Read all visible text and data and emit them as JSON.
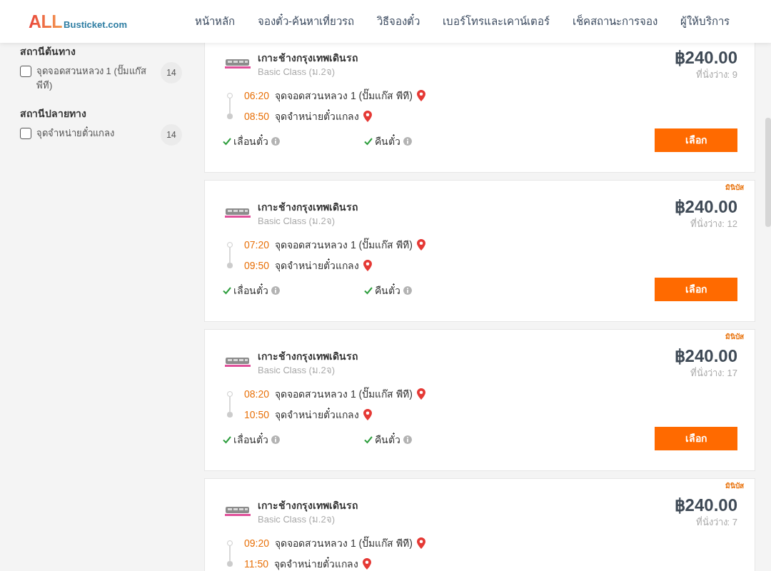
{
  "header": {
    "logo": {
      "brand": "ALL",
      "domain": "Busticket.com"
    },
    "nav": [
      {
        "label": "หน้าหลัก"
      },
      {
        "label": "จองตั๋ว-ค้นหาเที่ยวรถ"
      },
      {
        "label": "วิธีจองตั๋ว"
      },
      {
        "label": "เบอร์โทรและเคาน์เตอร์"
      },
      {
        "label": "เช็คสถานะการจอง"
      },
      {
        "label": "ผู้ให้บริการ"
      }
    ]
  },
  "filters": [
    {
      "heading": "สถานีต้นทาง",
      "options": [
        {
          "label": "จุดจอดสวนหลวง 1 (ปั๊มแก๊ส พีที)",
          "count": "14",
          "checked": false
        }
      ]
    },
    {
      "heading": "สถานีปลายทาง",
      "options": [
        {
          "label": "จุดจำหน่ายตั๋วแกลง",
          "count": "14",
          "checked": false
        }
      ]
    }
  ],
  "trips": [
    {
      "operator": "เกาะช้างกรุงเทพเดินรถ",
      "service_class": "Basic Class (ม.2จ)",
      "price": "฿240.00",
      "seats": "ที่นั่งว่าง: 9",
      "stops": [
        {
          "time": "06:20",
          "station": "จุดจอดสวนหลวง 1 (ปั๊มแก๊ส พีที)"
        },
        {
          "time": "08:50",
          "station": "จุดจำหน่ายตั๋วแกลง"
        }
      ],
      "features": [
        {
          "label": "เลื่อนตั๋ว",
          "available": true
        },
        {
          "label": "คืนตั๋ว",
          "available": true
        }
      ],
      "button": "เลือก"
    },
    {
      "tag": "มินิบัส",
      "operator": "เกาะช้างกรุงเทพเดินรถ",
      "service_class": "Basic Class (ม.2จ)",
      "price": "฿240.00",
      "seats": "ที่นั่งว่าง: 12",
      "stops": [
        {
          "time": "07:20",
          "station": "จุดจอดสวนหลวง 1 (ปั๊มแก๊ส พีที)"
        },
        {
          "time": "09:50",
          "station": "จุดจำหน่ายตั๋วแกลง"
        }
      ],
      "features": [
        {
          "label": "เลื่อนตั๋ว",
          "available": true
        },
        {
          "label": "คืนตั๋ว",
          "available": true
        }
      ],
      "button": "เลือก"
    },
    {
      "tag": "มินิบัส",
      "operator": "เกาะช้างกรุงเทพเดินรถ",
      "service_class": "Basic Class (ม.2จ)",
      "price": "฿240.00",
      "seats": "ที่นั่งว่าง: 17",
      "stops": [
        {
          "time": "08:20",
          "station": "จุดจอดสวนหลวง 1 (ปั๊มแก๊ส พีที)"
        },
        {
          "time": "10:50",
          "station": "จุดจำหน่ายตั๋วแกลง"
        }
      ],
      "features": [
        {
          "label": "เลื่อนตั๋ว",
          "available": true
        },
        {
          "label": "คืนตั๋ว",
          "available": true
        }
      ],
      "button": "เลือก"
    },
    {
      "tag": "มินิบัส",
      "operator": "เกาะช้างกรุงเทพเดินรถ",
      "service_class": "Basic Class (ม.2จ)",
      "price": "฿240.00",
      "seats": "ที่นั่งว่าง: 7",
      "stops": [
        {
          "time": "09:20",
          "station": "จุดจอดสวนหลวง 1 (ปั๊มแก๊ส พีที)"
        },
        {
          "time": "11:50",
          "station": "จุดจำหน่ายตั๋วแกลง"
        }
      ]
    }
  ]
}
